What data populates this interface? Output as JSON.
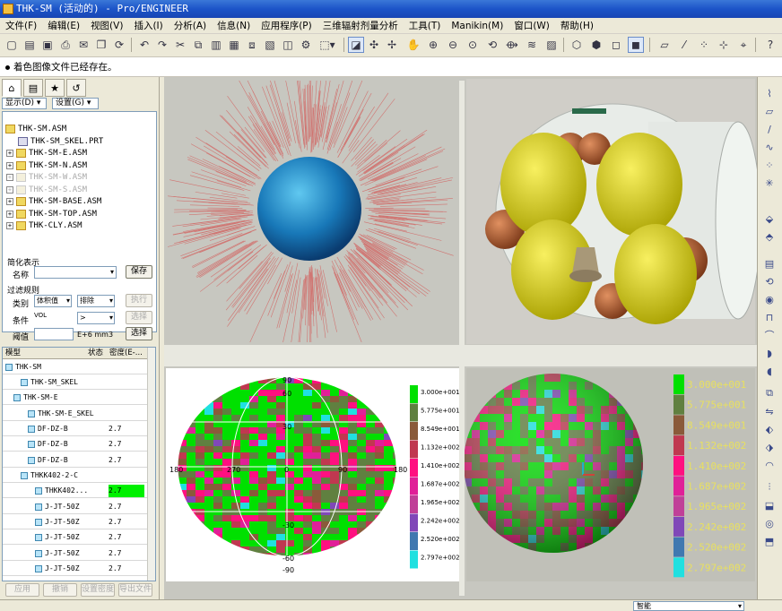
{
  "window": {
    "title": "THK-SM (活动的) - Pro/ENGINEER"
  },
  "menu": [
    "文件(F)",
    "编辑(E)",
    "视图(V)",
    "插入(I)",
    "分析(A)",
    "信息(N)",
    "应用程序(P)",
    "三维辐射剂量分析",
    "工具(T)",
    "Manikin(M)",
    "窗口(W)",
    "帮助(H)"
  ],
  "message": "着色图像文件已经存在。",
  "panel": {
    "show_btn": "显示(D) ▾",
    "settings_btn": "设置(G) ▾",
    "tree": [
      {
        "label": "THK-SM.ASM",
        "dim": false
      },
      {
        "label": "THK-SM_SKEL.PRT",
        "dim": false
      },
      {
        "label": "THK-SM-E.ASM",
        "dim": false
      },
      {
        "label": "THK-SM-N.ASM",
        "dim": false
      },
      {
        "label": "THK-SM-W.ASM",
        "dim": true
      },
      {
        "label": "THK-SM-S.ASM",
        "dim": true
      },
      {
        "label": "THK-SM-BASE.ASM",
        "dim": false
      },
      {
        "label": "THK-SM-TOP.ASM",
        "dim": false
      },
      {
        "label": "THK-CLY.ASM",
        "dim": false
      }
    ],
    "simplified": {
      "section": "简化表示",
      "name_label": "名称",
      "save_btn": "保存"
    },
    "filter": {
      "section": "过滤规则",
      "type_label": "类别",
      "type_value": "体积值",
      "mode_value": "排除",
      "exec_btn": "执行",
      "cond_label": "条件",
      "cond_value": "VOL",
      "op_value": ">",
      "select_btn1": "选择",
      "threshold_label": "阈值",
      "unit": "E+6 mm3",
      "select_btn2": "选择"
    },
    "grid": {
      "headers": [
        "模型",
        "状态",
        "密度(E-..."
      ],
      "rows": [
        {
          "name": "THK-SM",
          "density": ""
        },
        {
          "name": "THK-SM_SKEL",
          "density": ""
        },
        {
          "name": "THK-SM-E",
          "density": ""
        },
        {
          "name": "THK-SM-E_SKEL",
          "density": ""
        },
        {
          "name": "DF-DZ-B",
          "density": "2.7"
        },
        {
          "name": "DF-DZ-B",
          "density": "2.7"
        },
        {
          "name": "DF-DZ-B",
          "density": "2.7"
        },
        {
          "name": "THKK402-2-C",
          "density": ""
        },
        {
          "name": "THKK402...",
          "density": "2.7"
        },
        {
          "name": "J-JT-50Z",
          "density": "2.7"
        },
        {
          "name": "J-JT-50Z",
          "density": "2.7"
        },
        {
          "name": "J-JT-50Z",
          "density": "2.7"
        },
        {
          "name": "J-JT-50Z",
          "density": "2.7"
        },
        {
          "name": "J-JT-50Z",
          "density": "2.7"
        }
      ]
    },
    "bottom_buttons": [
      "应用",
      "撤销",
      "设置密度",
      "导出文件"
    ]
  },
  "map": {
    "ticks_top": [
      "90",
      "60",
      "30"
    ],
    "ticks_bottom": [
      "-30",
      "-60",
      "-90"
    ],
    "ticks_mid": [
      "180",
      "270",
      "0",
      "90",
      "180"
    ]
  },
  "legend": {
    "labels": [
      "3.000e+001",
      "5.775e+001",
      "8.549e+001",
      "1.132e+002",
      "1.410e+002",
      "1.687e+002",
      "1.965e+002",
      "2.242e+002",
      "2.520e+002",
      "2.797e+002"
    ],
    "colors": [
      "#00e000",
      "#608040",
      "#8a5a3a",
      "#c03850",
      "#ff1080",
      "#e02098",
      "#c04098",
      "#8048b8",
      "#4078b0",
      "#20e0e0"
    ]
  },
  "status": {
    "select": "智能"
  }
}
